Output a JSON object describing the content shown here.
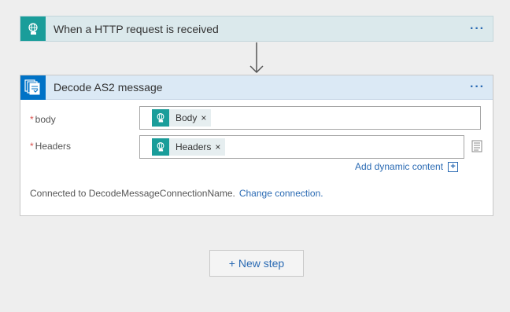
{
  "trigger": {
    "title": "When a HTTP request is received",
    "menu": "···",
    "icon": "globe-hand-icon"
  },
  "action": {
    "title": "Decode AS2 message",
    "menu": "···",
    "icon": "as2-documents-icon",
    "fields": [
      {
        "required_mark": "*",
        "label": "body",
        "token": "Body",
        "remove": "×"
      },
      {
        "required_mark": "*",
        "label": "Headers",
        "token": "Headers",
        "remove": "×"
      }
    ],
    "dynamic_content": "Add dynamic content",
    "dynamic_plus": "+",
    "connection_text": "Connected to DecodeMessageConnectionName.",
    "change_connection": "Change connection."
  },
  "new_step": "+ New step",
  "colors": {
    "trigger_bg": "#dbe9ec",
    "trigger_icon": "#1a9d9a",
    "action_header_bg": "#dbe9f5",
    "action_icon": "#0072c6",
    "link": "#2a6ab3"
  }
}
